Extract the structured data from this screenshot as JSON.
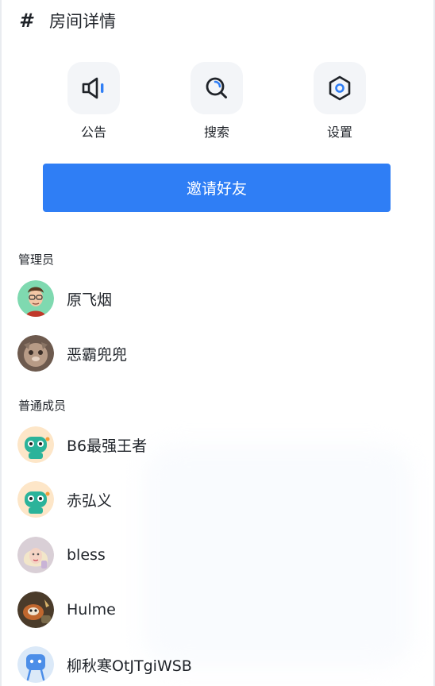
{
  "header": {
    "hash_symbol": "#",
    "title": "房间详情"
  },
  "actions": [
    {
      "label": "公告",
      "icon": "megaphone-icon"
    },
    {
      "label": "搜索",
      "icon": "search-icon"
    },
    {
      "label": "设置",
      "icon": "gear-icon"
    }
  ],
  "invite_button": {
    "label": "邀请好友"
  },
  "sections": {
    "admins": "管理员",
    "members": "普通成员"
  },
  "admins": [
    {
      "name": "原飞烟"
    },
    {
      "name": "恶霸兜兜"
    }
  ],
  "members": [
    {
      "name": "B6最强王者"
    },
    {
      "name": "赤弘义"
    },
    {
      "name": "bless"
    },
    {
      "name": "Hulme"
    },
    {
      "name": "柳秋寒OtJTgiWSB"
    }
  ],
  "colors": {
    "accent": "#2f7ef5",
    "icon_bg": "#f3f5f8",
    "text": "#1f2329"
  }
}
